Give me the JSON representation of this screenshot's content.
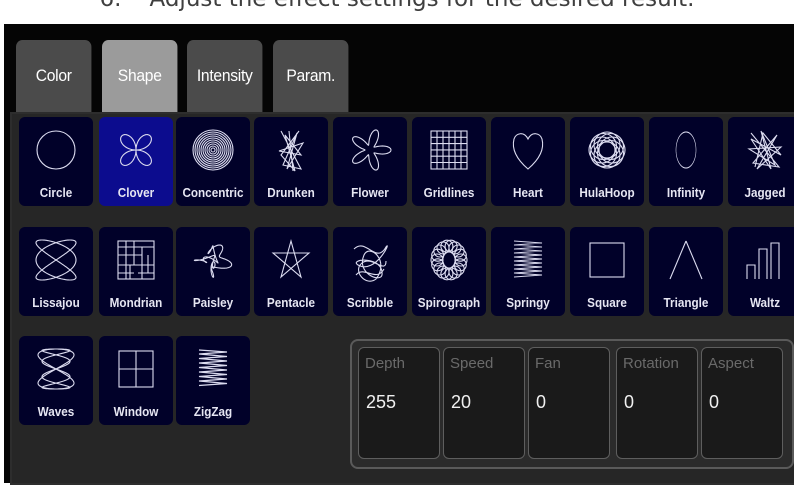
{
  "instruction": {
    "number": "6.",
    "text": "Adjust the effect settings for the desired result."
  },
  "tabs": [
    {
      "label": "Color",
      "active": false
    },
    {
      "label": "Shape",
      "active": true
    },
    {
      "label": "Intensity",
      "active": false
    },
    {
      "label": "Param.",
      "active": false
    }
  ],
  "shapes": [
    {
      "label": "Circle",
      "icon": "circle-icon",
      "selected": false
    },
    {
      "label": "Clover",
      "icon": "clover-icon",
      "selected": true
    },
    {
      "label": "Concentric",
      "icon": "concentric-icon",
      "selected": false
    },
    {
      "label": "Drunken",
      "icon": "drunken-icon",
      "selected": false
    },
    {
      "label": "Flower",
      "icon": "flower-icon",
      "selected": false
    },
    {
      "label": "Gridlines",
      "icon": "gridlines-icon",
      "selected": false
    },
    {
      "label": "Heart",
      "icon": "heart-icon",
      "selected": false
    },
    {
      "label": "HulaHoop",
      "icon": "hulahoop-icon",
      "selected": false
    },
    {
      "label": "Infinity",
      "icon": "infinity-icon",
      "selected": false
    },
    {
      "label": "Jagged",
      "icon": "jagged-icon",
      "selected": false
    },
    {
      "label": "Lissajou",
      "icon": "lissajou-icon",
      "selected": false
    },
    {
      "label": "Mondrian",
      "icon": "mondrian-icon",
      "selected": false
    },
    {
      "label": "Paisley",
      "icon": "paisley-icon",
      "selected": false
    },
    {
      "label": "Pentacle",
      "icon": "pentacle-icon",
      "selected": false
    },
    {
      "label": "Scribble",
      "icon": "scribble-icon",
      "selected": false
    },
    {
      "label": "Spirograph",
      "icon": "spirograph-icon",
      "selected": false
    },
    {
      "label": "Springy",
      "icon": "springy-icon",
      "selected": false
    },
    {
      "label": "Square",
      "icon": "square-icon",
      "selected": false
    },
    {
      "label": "Triangle",
      "icon": "triangle-icon",
      "selected": false
    },
    {
      "label": "Waltz",
      "icon": "waltz-icon",
      "selected": false
    },
    {
      "label": "Waves",
      "icon": "waves-icon",
      "selected": false
    },
    {
      "label": "Window",
      "icon": "window-icon",
      "selected": false
    },
    {
      "label": "ZigZag",
      "icon": "zigzag-icon",
      "selected": false
    }
  ],
  "parameters": [
    {
      "label": "Depth",
      "value": "255"
    },
    {
      "label": "Speed",
      "value": "20"
    },
    {
      "label": "Fan",
      "value": "0"
    },
    {
      "label": "Rotation",
      "value": "0"
    },
    {
      "label": "Aspect",
      "value": "0"
    }
  ],
  "colors": {
    "button_bg": "#010129",
    "button_selected_bg": "#0c0c8e",
    "tab_bg": "#4b4b4b",
    "tab_active_bg": "#9b9b9b"
  }
}
